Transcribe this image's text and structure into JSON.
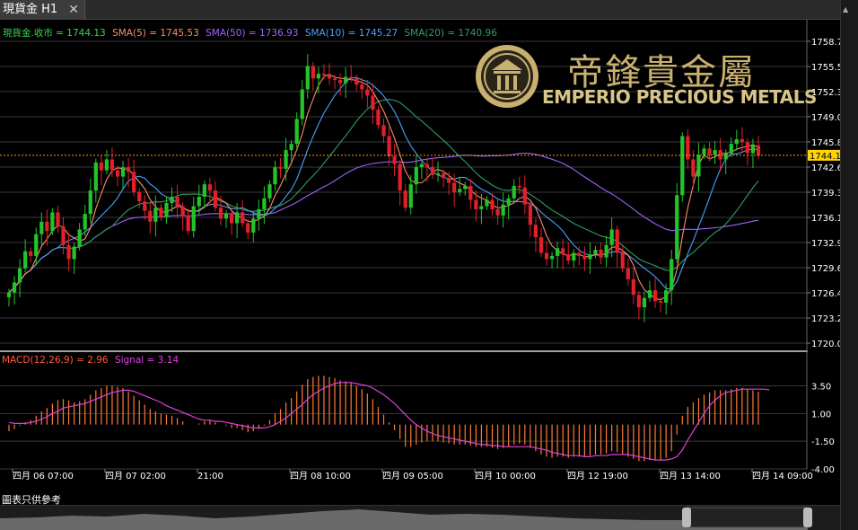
{
  "tab": {
    "title": "現貨金 H1",
    "close_glyph": "✕"
  },
  "header": {
    "items": [
      {
        "text": "現貨金.收市 = 1744.13",
        "color": "#39d353"
      },
      {
        "text": "SMA(5) = 1745.53",
        "color": "#ff8a6a"
      },
      {
        "text": "SMA(50) = 1736.93",
        "color": "#a060ff"
      },
      {
        "text": "SMA(10) = 1745.27",
        "color": "#4aa0ff"
      },
      {
        "text": "SMA(20) = 1740.96",
        "color": "#2e9e62"
      }
    ]
  },
  "logo": {
    "cn": "帝鋒貴金屬",
    "en": "EMPERIO PRECIOUS METALS"
  },
  "price_axis": {
    "ticks": [
      "1758.77",
      "1755.54",
      "1752.31",
      "1749.08",
      "1745.85",
      "1742.62",
      "1739.38",
      "1736.15",
      "1732.92",
      "1729.69",
      "1726.46",
      "1723.23",
      "1720.00"
    ],
    "current_label": "1744.13"
  },
  "macd": {
    "label": "MACD(12,26,9) = 2.96",
    "signal_label": "Signal = 3.14",
    "ticks": [
      "3.50",
      "1.00",
      "-1.50",
      "-4.00"
    ]
  },
  "time_axis": {
    "labels": [
      "四月 06 07:00",
      "四月 07 02:00",
      "21:00",
      "四月 08 10:00",
      "四月 09 05:00",
      "四月 10 00:00",
      "四月 12 19:00",
      "四月 13 14:00",
      "四月 14 09:00"
    ]
  },
  "footnote": "圖表只供參考",
  "chart_data": {
    "type": "candlestick",
    "price_range": [
      1720.0,
      1758.77
    ],
    "current_price": 1744.13,
    "colors": {
      "up": "#22c42a",
      "down": "#e0202a",
      "macd_hist": "#ff7a33",
      "signal": "#e040e0"
    },
    "closes": [
      1726.5,
      1727.8,
      1729.6,
      1731.8,
      1731.2,
      1734.0,
      1735.6,
      1734.4,
      1736.8,
      1735.0,
      1732.6,
      1730.8,
      1732.4,
      1734.6,
      1736.6,
      1739.6,
      1743.2,
      1742.2,
      1743.6,
      1742.2,
      1741.4,
      1742.6,
      1742.0,
      1739.4,
      1738.2,
      1737.0,
      1735.6,
      1737.4,
      1736.2,
      1738.0,
      1738.8,
      1737.6,
      1736.4,
      1734.4,
      1737.6,
      1738.8,
      1740.4,
      1739.6,
      1737.4,
      1736.0,
      1736.6,
      1735.4,
      1736.8,
      1735.4,
      1734.2,
      1736.0,
      1737.2,
      1738.6,
      1740.4,
      1742.6,
      1742.4,
      1744.8,
      1745.6,
      1748.8,
      1752.6,
      1755.6,
      1754.0,
      1754.6,
      1754.4,
      1754.0,
      1753.8,
      1753.4,
      1754.2,
      1754.0,
      1753.2,
      1752.6,
      1751.8,
      1750.0,
      1748.0,
      1746.6,
      1744.0,
      1743.0,
      1739.6,
      1737.4,
      1740.4,
      1742.6,
      1743.0,
      1742.6,
      1741.6,
      1741.8,
      1741.2,
      1740.6,
      1739.4,
      1739.8,
      1740.2,
      1738.4,
      1737.2,
      1737.6,
      1738.4,
      1737.2,
      1736.4,
      1737.8,
      1738.6,
      1740.2,
      1740.0,
      1737.8,
      1735.2,
      1733.6,
      1731.6,
      1730.8,
      1731.2,
      1732.2,
      1731.4,
      1730.6,
      1731.6,
      1731.2,
      1730.8,
      1731.4,
      1732.0,
      1731.0,
      1732.6,
      1734.6,
      1731.6,
      1729.6,
      1728.2,
      1726.2,
      1724.6,
      1725.8,
      1726.8,
      1725.4,
      1725.2,
      1726.8,
      1730.8,
      1739.0,
      1746.6,
      1743.6,
      1741.4,
      1744.2,
      1745.0,
      1744.2,
      1744.8,
      1743.6,
      1744.4,
      1745.6,
      1746.2,
      1745.8,
      1744.4,
      1745.4,
      1744.13
    ],
    "macd_values": [
      -0.6,
      -0.4,
      -0.1,
      0.2,
      0.4,
      0.8,
      1.2,
      1.5,
      1.9,
      2.2,
      2.3,
      2.2,
      2.0,
      2.1,
      2.3,
      2.7,
      3.1,
      3.3,
      3.5,
      3.5,
      3.4,
      3.3,
      3.0,
      2.6,
      2.2,
      1.8,
      1.4,
      1.2,
      1.0,
      0.9,
      0.8,
      0.6,
      0.3,
      0.0,
      0.0,
      0.1,
      0.3,
      0.4,
      0.2,
      0.0,
      -0.1,
      -0.3,
      -0.3,
      -0.5,
      -0.7,
      -0.6,
      -0.4,
      -0.1,
      0.4,
      1.0,
      1.4,
      2.0,
      2.4,
      3.0,
      3.6,
      4.1,
      4.3,
      4.4,
      4.4,
      4.3,
      4.2,
      4.0,
      3.9,
      3.8,
      3.5,
      3.2,
      2.8,
      2.3,
      1.6,
      0.9,
      0.2,
      -0.5,
      -1.3,
      -2.0,
      -2.0,
      -1.8,
      -1.6,
      -1.5,
      -1.5,
      -1.5,
      -1.6,
      -1.7,
      -1.8,
      -1.8,
      -1.8,
      -1.9,
      -2.0,
      -2.0,
      -2.0,
      -2.1,
      -2.2,
      -2.1,
      -2.0,
      -1.8,
      -1.7,
      -1.8,
      -2.1,
      -2.4,
      -2.7,
      -2.9,
      -3.0,
      -2.9,
      -2.9,
      -3.0,
      -2.9,
      -2.9,
      -2.9,
      -2.8,
      -2.7,
      -2.7,
      -2.6,
      -2.4,
      -2.5,
      -2.7,
      -2.9,
      -3.1,
      -3.3,
      -3.3,
      -3.2,
      -3.2,
      -3.2,
      -3.0,
      -2.4,
      -0.9,
      0.8,
      1.6,
      2.0,
      2.4,
      2.7,
      2.9,
      3.1,
      3.1,
      3.1,
      3.2,
      3.3,
      3.3,
      3.2,
      3.1,
      2.96
    ],
    "signal_values": [
      0.2,
      0.1,
      0.1,
      0.1,
      0.2,
      0.3,
      0.5,
      0.7,
      1.0,
      1.2,
      1.5,
      1.6,
      1.7,
      1.8,
      1.9,
      2.1,
      2.3,
      2.5,
      2.7,
      2.9,
      3.0,
      3.1,
      3.1,
      3.0,
      2.8,
      2.6,
      2.4,
      2.2,
      2.0,
      1.7,
      1.5,
      1.3,
      1.1,
      0.9,
      0.7,
      0.5,
      0.4,
      0.4,
      0.3,
      0.3,
      0.2,
      0.1,
      0.0,
      -0.1,
      -0.2,
      -0.3,
      -0.3,
      -0.3,
      -0.2,
      0.0,
      0.3,
      0.6,
      1.0,
      1.4,
      1.8,
      2.3,
      2.7,
      3.0,
      3.3,
      3.5,
      3.7,
      3.8,
      3.8,
      3.8,
      3.7,
      3.6,
      3.5,
      3.3,
      3.0,
      2.7,
      2.3,
      1.9,
      1.4,
      0.9,
      0.4,
      0.0,
      -0.3,
      -0.6,
      -0.8,
      -1.0,
      -1.1,
      -1.2,
      -1.3,
      -1.4,
      -1.5,
      -1.6,
      -1.7,
      -1.8,
      -1.8,
      -1.9,
      -1.9,
      -2.0,
      -2.0,
      -2.0,
      -2.0,
      -2.0,
      -2.0,
      -2.1,
      -2.2,
      -2.3,
      -2.5,
      -2.6,
      -2.7,
      -2.8,
      -2.8,
      -2.8,
      -2.9,
      -2.9,
      -2.8,
      -2.8,
      -2.8,
      -2.7,
      -2.7,
      -2.7,
      -2.7,
      -2.8,
      -2.9,
      -3.0,
      -3.1,
      -3.2,
      -3.2,
      -3.2,
      -3.1,
      -2.9,
      -2.3,
      -1.4,
      -0.6,
      0.2,
      1.0,
      1.7,
      2.2,
      2.6,
      2.9,
      3.0,
      3.1,
      3.2,
      3.2,
      3.2,
      3.2,
      3.2,
      3.14
    ],
    "macd_range": [
      -4.0,
      5.0
    ]
  }
}
